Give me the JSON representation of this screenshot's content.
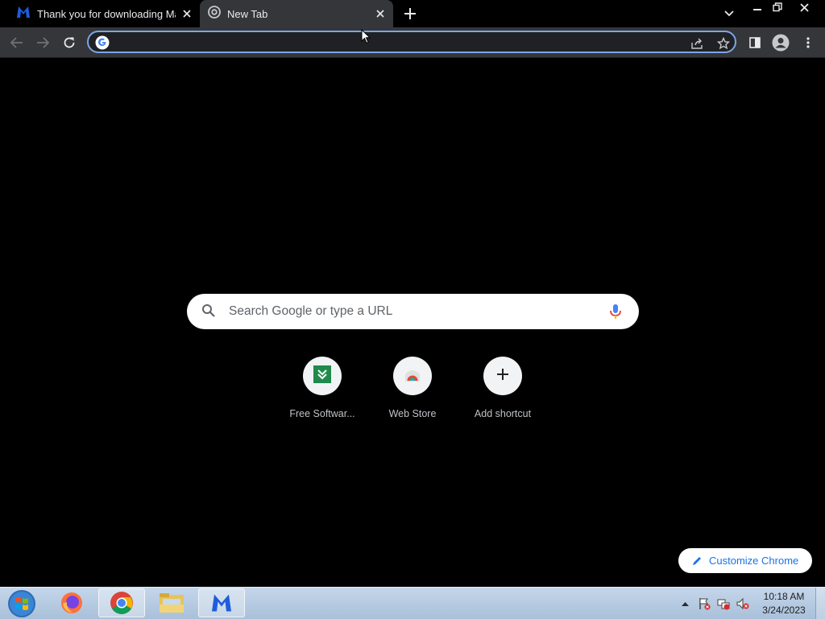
{
  "browser": {
    "tabs": [
      {
        "title": "Thank you for downloading Malw",
        "icon": "malwarebytes-icon"
      },
      {
        "title": "New Tab",
        "icon": "chrome-icon"
      }
    ],
    "omnibox": {
      "value": "",
      "placeholder": ""
    }
  },
  "ntp": {
    "search_placeholder": "Search Google or type a URL",
    "shortcuts": [
      {
        "label": "Free Softwar...",
        "icon": "download-icon"
      },
      {
        "label": "Web Store",
        "icon": "web-store-icon"
      },
      {
        "label": "Add shortcut",
        "icon": "plus-icon"
      }
    ],
    "customize_label": "Customize Chrome"
  },
  "taskbar": {
    "apps": [
      "firefox",
      "chrome",
      "file-explorer",
      "malwarebytes"
    ],
    "clock": {
      "time": "10:18 AM",
      "date": "3/24/2023"
    }
  },
  "colors": {
    "accent": "#7ca5e8",
    "toolbar": "#35363a",
    "link": "#1a73e8"
  }
}
